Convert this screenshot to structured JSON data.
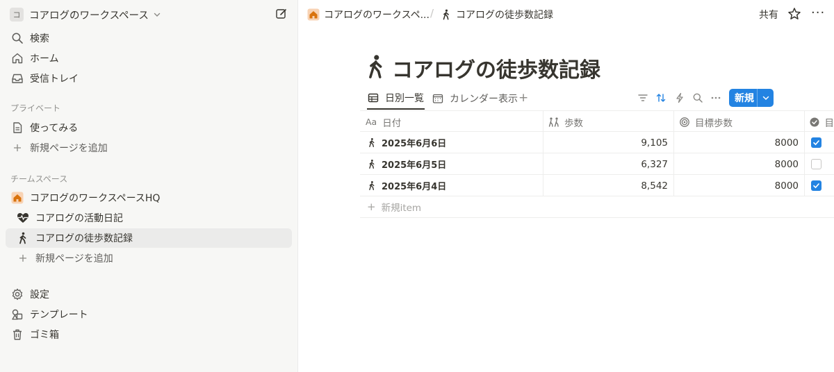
{
  "sidebar": {
    "workspace_icon": "コ",
    "workspace_name": "コアログのワークスペース",
    "nav": [
      {
        "label": "検索",
        "icon": "search-icon"
      },
      {
        "label": "ホーム",
        "icon": "home-icon"
      },
      {
        "label": "受信トレイ",
        "icon": "inbox-icon"
      }
    ],
    "private_title": "プライベート",
    "private_items": [
      {
        "label": "使ってみる",
        "icon": "page-icon"
      },
      {
        "label": "新規ページを追加",
        "icon": "plus-icon"
      }
    ],
    "team_title": "チームスペース",
    "team_items": [
      {
        "label": "コアログのワークスペースHQ",
        "icon": "home-icon"
      },
      {
        "label": "コアログの活動日記",
        "icon": "heartbeat-icon"
      },
      {
        "label": "コアログの徒歩数記録",
        "icon": "walking-icon"
      },
      {
        "label": "新規ページを追加",
        "icon": "plus-icon"
      }
    ],
    "bottom_items": [
      {
        "label": "設定",
        "icon": "gear-icon"
      },
      {
        "label": "テンプレート",
        "icon": "template-icon"
      },
      {
        "label": "ゴミ箱",
        "icon": "trash-icon"
      }
    ]
  },
  "topbar": {
    "breadcrumb": [
      "コアログのワークスペ...",
      "コアログの徒歩数記録"
    ],
    "separator": "/",
    "share_label": "共有",
    "more_label": "···"
  },
  "page": {
    "title": "コアログの徒歩数記録",
    "views": [
      {
        "label": "日別一覧",
        "icon": "table-icon",
        "active": true
      },
      {
        "label": "カレンダー表示",
        "icon": "calendar-icon",
        "active": false
      }
    ],
    "add_view": "+",
    "new_button": "新規"
  },
  "table": {
    "columns": [
      {
        "label": "日付",
        "icon": "Aa"
      },
      {
        "label": "歩数",
        "icon": "people-icon"
      },
      {
        "label": "目標歩数",
        "icon": "target-icon"
      },
      {
        "label": "目",
        "icon": "checkbox-icon"
      }
    ],
    "rows": [
      {
        "date": "2025年6月6日",
        "steps": "9,105",
        "goal": "8000",
        "achieved": true
      },
      {
        "date": "2025年6月5日",
        "steps": "6,327",
        "goal": "8000",
        "achieved": false
      },
      {
        "date": "2025年6月4日",
        "steps": "8,542",
        "goal": "8000",
        "achieved": true
      }
    ],
    "new_item_label": "新規item"
  },
  "colors": {
    "accent": "#2383e2",
    "sidebar_bg": "#f7f7f5",
    "text": "#37352f",
    "home_icon_bg": "#f8d3b4",
    "home_icon_fg": "#d9730d"
  }
}
